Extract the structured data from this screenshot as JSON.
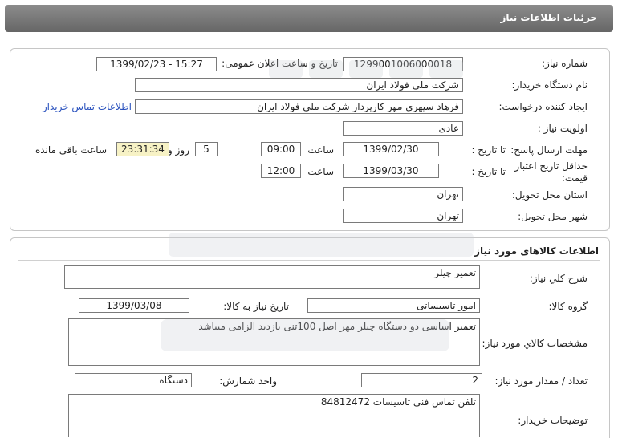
{
  "header": {
    "title": "جزئیات اطلاعات نیاز"
  },
  "need_info": {
    "need_number_label": "شماره نیاز:",
    "need_number": "1299001006000018",
    "announce_label": "تاریخ و ساعت اعلان عمومی:",
    "announce_value": "1399/02/23 - 15:27",
    "buyer_org_label": "نام دستگاه خریدار:",
    "buyer_org": "شرکت ملی فولاد ایران",
    "requester_label": "ایجاد کننده درخواست:",
    "requester": "فرهاد سپهری مهر کارپرداز شرکت ملی فولاد ایران",
    "contact_link": "اطلاعات تماس خریدار",
    "priority_label": "اولویت نیاز :",
    "priority": "عادی",
    "deadline_label": "مهلت ارسال پاسخ:",
    "to_date_label": "تا تاریخ :",
    "deadline_date": "1399/02/30",
    "time_label": "ساعت",
    "deadline_time": "09:00",
    "days_value": "5",
    "days_label": "روز و",
    "remaining_time": "23:31:34",
    "remaining_label": "ساعت باقی مانده",
    "validity_label": "حداقل تاریخ اعتبار قیمت:",
    "validity_to_label": "تا تاریخ :",
    "validity_date": "1399/03/30",
    "validity_time_label": "ساعت",
    "validity_time": "12:00",
    "province_label": "استان محل تحویل:",
    "province": "تهران",
    "city_label": "شهر محل تحویل:",
    "city": "تهران"
  },
  "goods": {
    "section_title": "اطلاعات کالاهای مورد نیاز",
    "summary_label": "شرح کلي نياز:",
    "summary": "تعمیر چیلر",
    "group_label": "گروه کالا:",
    "group": "امور تاسیساتی",
    "need_date_label": "تاریخ نیاز به کالا:",
    "need_date": "1399/03/08",
    "specs_label": "مشخصات کالاي مورد نياز:",
    "specs": "تعمیر اساسی دو دستگاه چیلر مهر اصل 100تنی بازدید الزامی میباشد",
    "qty_label": "تعداد / مقدار مورد نیاز:",
    "qty": "2",
    "unit_label": "واحد شمارش:",
    "unit": "دستگاه",
    "buyer_notes_label": "توضیحات خریدار:",
    "buyer_notes": "تلفن تماس فنی تاسیسات 84812472"
  }
}
